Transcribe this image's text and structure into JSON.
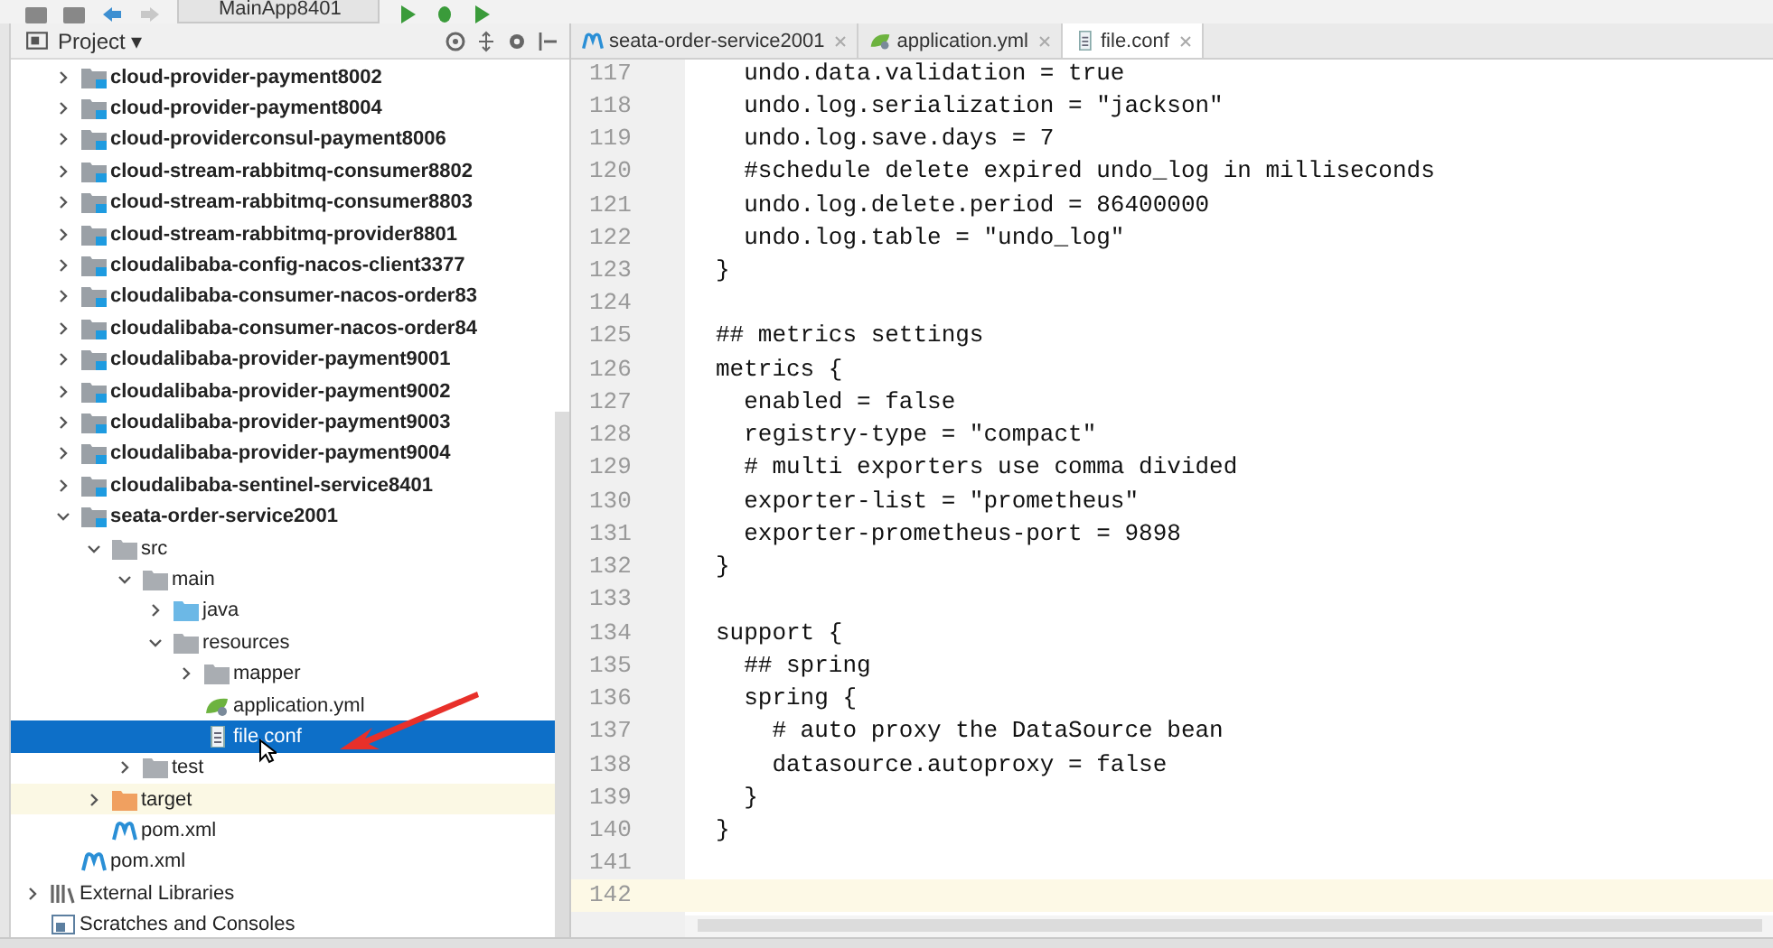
{
  "toolbar": {
    "run_config": "MainApp8401"
  },
  "project_panel": {
    "title": "Project ▾",
    "tree": [
      {
        "label": "cloud-provider-payment8002",
        "kind": "module",
        "expanded": false,
        "selected": false
      },
      {
        "label": "cloud-provider-payment8004",
        "kind": "module",
        "expanded": false,
        "selected": false
      },
      {
        "label": "cloud-providerconsul-payment8006",
        "kind": "module",
        "expanded": false,
        "selected": false
      },
      {
        "label": "cloud-stream-rabbitmq-consumer8802",
        "kind": "module",
        "expanded": false,
        "selected": false
      },
      {
        "label": "cloud-stream-rabbitmq-consumer8803",
        "kind": "module",
        "expanded": false,
        "selected": false
      },
      {
        "label": "cloud-stream-rabbitmq-provider8801",
        "kind": "module",
        "expanded": false,
        "selected": false
      },
      {
        "label": "cloudalibaba-config-nacos-client3377",
        "kind": "module",
        "expanded": false,
        "selected": false
      },
      {
        "label": "cloudalibaba-consumer-nacos-order83",
        "kind": "module",
        "expanded": false,
        "selected": false
      },
      {
        "label": "cloudalibaba-consumer-nacos-order84",
        "kind": "module",
        "expanded": false,
        "selected": false
      },
      {
        "label": "cloudalibaba-provider-payment9001",
        "kind": "module",
        "expanded": false,
        "selected": false
      },
      {
        "label": "cloudalibaba-provider-payment9002",
        "kind": "module",
        "expanded": false,
        "selected": false
      },
      {
        "label": "cloudalibaba-provider-payment9003",
        "kind": "module",
        "expanded": false,
        "selected": false
      },
      {
        "label": "cloudalibaba-provider-payment9004",
        "kind": "module",
        "expanded": false,
        "selected": false
      },
      {
        "label": "cloudalibaba-sentinel-service8401",
        "kind": "module",
        "expanded": false,
        "selected": false
      },
      {
        "label": "seata-order-service2001",
        "kind": "module",
        "expanded": true,
        "selected": false,
        "children": [
          {
            "label": "src",
            "kind": "folder",
            "expanded": true,
            "selected": false,
            "children": [
              {
                "label": "main",
                "kind": "folder",
                "expanded": true,
                "selected": false,
                "children": [
                  {
                    "label": "java",
                    "kind": "source_folder",
                    "expanded": false,
                    "selected": false
                  },
                  {
                    "label": "resources",
                    "kind": "resources_folder",
                    "expanded": true,
                    "selected": false,
                    "children": [
                      {
                        "label": "mapper",
                        "kind": "package",
                        "expanded": false,
                        "selected": false
                      },
                      {
                        "label": "application.yml",
                        "kind": "yaml",
                        "selected": false
                      },
                      {
                        "label": "file.conf",
                        "kind": "conf",
                        "selected": true
                      }
                    ]
                  }
                ]
              },
              {
                "label": "test",
                "kind": "folder",
                "expanded": false,
                "selected": false
              }
            ]
          },
          {
            "label": "target",
            "kind": "excluded_folder",
            "expanded": false,
            "selected": false
          },
          {
            "label": "pom.xml",
            "kind": "maven",
            "selected": false
          }
        ]
      },
      {
        "label": "pom.xml",
        "kind": "maven",
        "selected": false
      }
    ],
    "other_nodes": [
      {
        "label": "External Libraries",
        "kind": "libraries",
        "expanded": false,
        "selected": false
      },
      {
        "label": "Scratches and Consoles",
        "kind": "scratches",
        "selected": false
      }
    ]
  },
  "editor": {
    "tabs": [
      {
        "label": "seata-order-service2001",
        "kind": "maven",
        "selected": false
      },
      {
        "label": "application.yml",
        "kind": "yaml",
        "selected": false
      },
      {
        "label": "file.conf",
        "kind": "conf",
        "selected": true
      }
    ],
    "lines": [
      {
        "number": "117",
        "text": "  undo.data.validation = true",
        "current": false
      },
      {
        "number": "118",
        "text": "  undo.log.serialization = \"jackson\"",
        "current": false
      },
      {
        "number": "119",
        "text": "  undo.log.save.days = 7",
        "current": false
      },
      {
        "number": "120",
        "text": "  #schedule delete expired undo_log in milliseconds",
        "current": false
      },
      {
        "number": "121",
        "text": "  undo.log.delete.period = 86400000",
        "current": false
      },
      {
        "number": "122",
        "text": "  undo.log.table = \"undo_log\"",
        "current": false
      },
      {
        "number": "123",
        "text": "}",
        "current": false
      },
      {
        "number": "124",
        "current": false
      },
      {
        "number": "125",
        "text": "## metrics settings",
        "current": false
      },
      {
        "number": "126",
        "text": "metrics {",
        "current": false
      },
      {
        "number": "127",
        "text": "  enabled = false",
        "current": false
      },
      {
        "number": "128",
        "text": "  registry-type = \"compact\"",
        "current": false
      },
      {
        "number": "129",
        "text": "  # multi exporters use comma divided",
        "current": false
      },
      {
        "number": "130",
        "text": "  exporter-list = \"prometheus\"",
        "current": false
      },
      {
        "number": "131",
        "text": "  exporter-prometheus-port = 9898",
        "current": false
      },
      {
        "number": "132",
        "text": "}",
        "current": false
      },
      {
        "number": "133",
        "current": false
      },
      {
        "number": "134",
        "text": "support {",
        "current": false
      },
      {
        "number": "135",
        "text": "  ## spring",
        "current": false
      },
      {
        "number": "136",
        "text": "  spring {",
        "current": false
      },
      {
        "number": "137",
        "text": "    # auto proxy the DataSource bean",
        "current": false
      },
      {
        "number": "138",
        "text": "    datasource.autoproxy = false",
        "current": false
      },
      {
        "number": "139",
        "text": "  }",
        "current": false
      },
      {
        "number": "140",
        "text": "}",
        "current": false
      },
      {
        "number": "141",
        "current": false
      },
      {
        "number": "142",
        "current": true
      }
    ]
  }
}
